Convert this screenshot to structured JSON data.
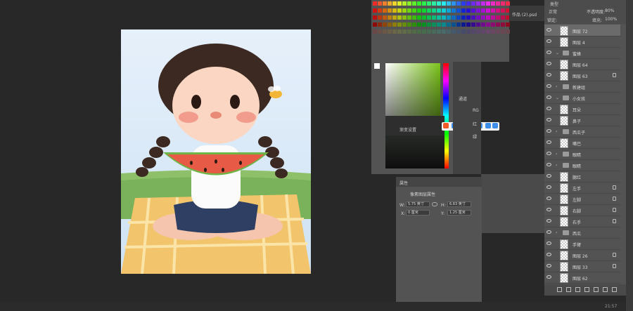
{
  "layers_panel": {
    "filter_kind": "类型",
    "blend_mode": "正常",
    "opacity_label": "不透明度:",
    "opacity_value": "80%",
    "lock_label": "锁定:",
    "fill_label": "填充:",
    "fill_value": "100%",
    "layers": [
      {
        "name": "图层 72",
        "type": "layer",
        "selected": true,
        "lock": false
      },
      {
        "name": "图层 4",
        "type": "layer",
        "selected": false,
        "lock": false
      },
      {
        "name": "蜜蜂",
        "type": "group",
        "open": true,
        "lock": false
      },
      {
        "name": "图层 64",
        "type": "layer",
        "selected": false,
        "lock": false
      },
      {
        "name": "图层 63",
        "type": "layer",
        "selected": false,
        "lock": true
      },
      {
        "name": "新建组",
        "type": "group",
        "open": false,
        "lock": false
      },
      {
        "name": "小女孩",
        "type": "group",
        "open": true,
        "lock": false
      },
      {
        "name": "耳朵",
        "type": "layer",
        "selected": false,
        "lock": false
      },
      {
        "name": "鼻子",
        "type": "layer",
        "selected": false,
        "lock": false
      },
      {
        "name": "西瓜子",
        "type": "group",
        "open": false,
        "lock": false
      },
      {
        "name": "嘴巴",
        "type": "layer",
        "selected": false,
        "lock": false
      },
      {
        "name": "眼睛",
        "type": "group",
        "open": false,
        "lock": false
      },
      {
        "name": "眼睛",
        "type": "group",
        "open": false,
        "lock": false
      },
      {
        "name": "腮红",
        "type": "layer",
        "selected": false,
        "lock": false
      },
      {
        "name": "左手",
        "type": "layer",
        "selected": false,
        "lock": true
      },
      {
        "name": "左脚",
        "type": "layer",
        "selected": false,
        "lock": true
      },
      {
        "name": "右脚",
        "type": "layer",
        "selected": false,
        "lock": true
      },
      {
        "name": "右手",
        "type": "layer",
        "selected": false,
        "lock": true
      },
      {
        "name": "西瓜",
        "type": "group",
        "open": false,
        "lock": false
      },
      {
        "name": "手臂",
        "type": "layer",
        "selected": false,
        "lock": false
      },
      {
        "name": "图层 26",
        "type": "layer",
        "selected": false,
        "lock": true
      },
      {
        "name": "图层 33",
        "type": "layer",
        "selected": false,
        "lock": true
      },
      {
        "name": "图层 62",
        "type": "layer",
        "selected": false,
        "lock": false
      }
    ],
    "footer_icons": [
      "link-icon",
      "fx-icon",
      "mask-icon",
      "adjustment-icon",
      "folder-icon",
      "new-layer-icon",
      "trash-icon"
    ]
  },
  "document_tab": {
    "title": "作品 (2).psd"
  },
  "channels_panel": {
    "title": "通道",
    "rows": [
      {
        "label": "RG"
      },
      {
        "label": "红"
      },
      {
        "label": "绿"
      }
    ]
  },
  "gradient_popup": {
    "label": "渐变设置"
  },
  "properties_panel": {
    "title": "属性",
    "section": "像素图层属性",
    "w_label": "W:",
    "w_value": "5.75 英寸",
    "h_label": "H:",
    "h_value": "6.83 英寸",
    "x_label": "X:",
    "x_value": "0 厘米",
    "y_label": "Y:",
    "y_value": "1.25 厘米"
  },
  "status_bar": {
    "time": "21:57"
  },
  "colors": {
    "panel": "#535353",
    "workspace": "#282828",
    "green_hue": "#7ac31a",
    "ime_logo": "#f05a28"
  }
}
